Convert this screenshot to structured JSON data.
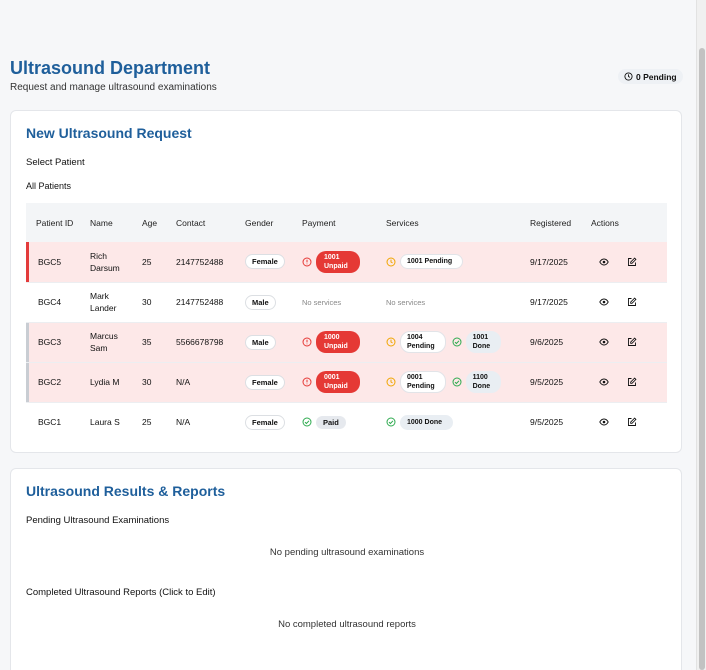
{
  "header": {
    "title": "Ultrasound Department",
    "subtitle": "Request and manage ultrasound examinations",
    "pending_badge": "0 Pending"
  },
  "request_card": {
    "title": "New Ultrasound Request",
    "select_label": "Select Patient",
    "all_label": "All Patients",
    "columns": [
      "Patient ID",
      "Name",
      "Age",
      "Contact",
      "Gender",
      "Payment",
      "Services",
      "Registered",
      "Actions"
    ],
    "rows": [
      {
        "id": "BGC5",
        "name": "Rich Darsum",
        "age": "25",
        "contact": "2147752488",
        "gender": "Female",
        "payment_code": "1001",
        "payment_status": "Unpaid",
        "svc1_code": "1001",
        "svc1_status": "Pending",
        "registered": "9/17/2025"
      },
      {
        "id": "BGC4",
        "name": "Mark Lander",
        "age": "30",
        "contact": "2147752488",
        "gender": "Male",
        "payment_none": "No services",
        "services_none": "No services",
        "registered": "9/17/2025"
      },
      {
        "id": "BGC3",
        "name": "Marcus Sam",
        "age": "35",
        "contact": "5566678798",
        "gender": "Male",
        "payment_code": "1000",
        "payment_status": "Unpaid",
        "svc1_code": "1004",
        "svc1_status": "Pending",
        "svc2_code": "1001",
        "svc2_status": "Done",
        "registered": "9/6/2025"
      },
      {
        "id": "BGC2",
        "name": "Lydia M",
        "age": "30",
        "contact": "N/A",
        "gender": "Female",
        "payment_code": "0001",
        "payment_status": "Unpaid",
        "svc1_code": "0001",
        "svc1_status": "Pending",
        "svc2_code": "1100",
        "svc2_status": "Done",
        "registered": "9/5/2025"
      },
      {
        "id": "BGC1",
        "name": "Laura S",
        "age": "25",
        "contact": "N/A",
        "gender": "Female",
        "payment_paid": "Paid",
        "svc1_code": "1000",
        "svc1_status": "Done",
        "registered": "9/5/2025"
      }
    ]
  },
  "results_card": {
    "title": "Ultrasound Results & Reports",
    "pending_label": "Pending Ultrasound Examinations",
    "pending_empty": "No pending ultrasound examinations",
    "completed_label": "Completed Ultrasound Reports (Click to Edit)",
    "completed_empty": "No completed ultrasound reports"
  },
  "icons": {
    "pending_badge": "clock-icon",
    "unpaid": "alert-circle-icon",
    "service_pending": "clock-icon",
    "done": "check-circle-icon",
    "view": "eye-icon",
    "edit": "edit-icon"
  },
  "colors": {
    "brand": "#1f5f9b",
    "unpaid": "#e53935",
    "pending": "#f0a500",
    "done": "#2eaa4f",
    "row_highlight": "#fde8e8"
  }
}
